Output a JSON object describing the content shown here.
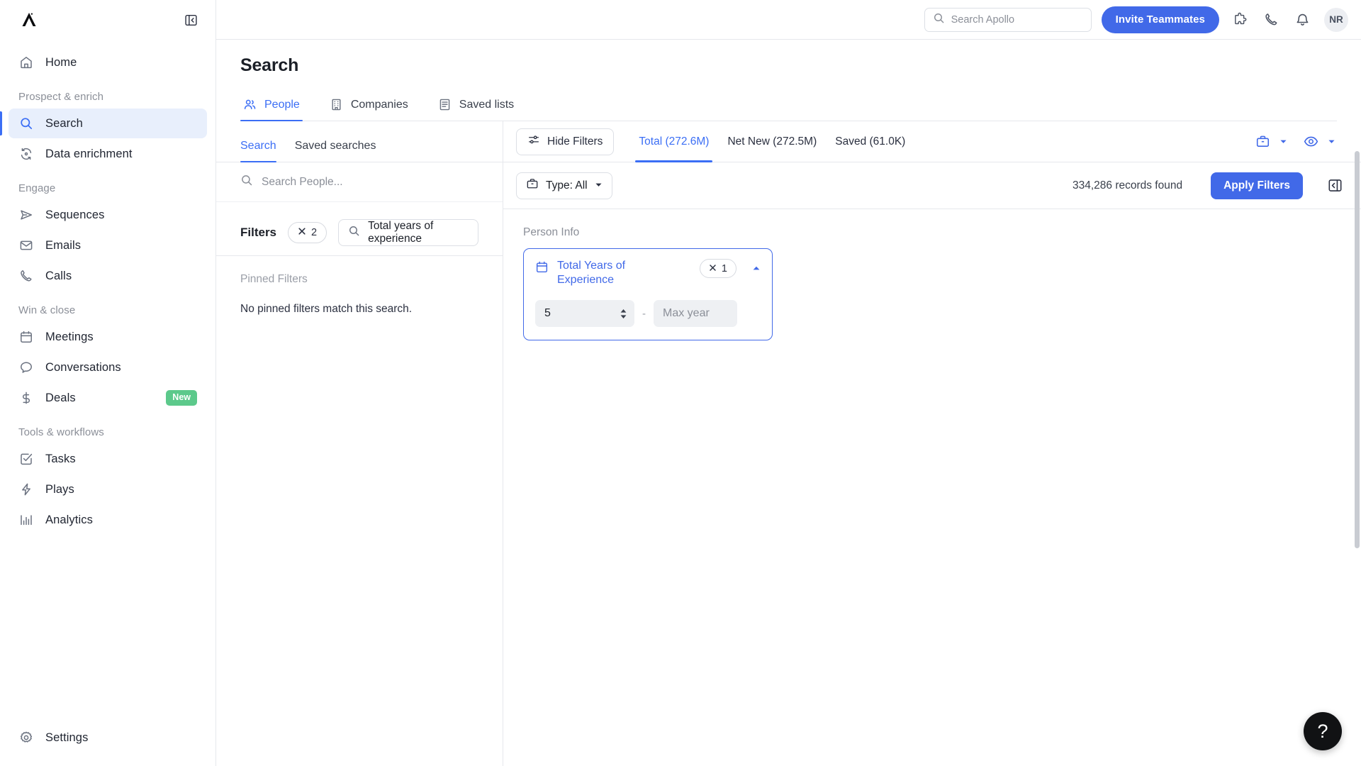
{
  "sidebar": {
    "logo": "apollo-logo",
    "collapse_icon": "panel-collapse-icon",
    "home": {
      "label": "Home",
      "icon": "home-icon"
    },
    "groups": [
      {
        "label": "Prospect & enrich",
        "items": [
          {
            "label": "Search",
            "icon": "search-icon",
            "active": true
          },
          {
            "label": "Data enrichment",
            "icon": "refresh-data-icon",
            "active": false
          }
        ]
      },
      {
        "label": "Engage",
        "items": [
          {
            "label": "Sequences",
            "icon": "send-icon",
            "active": false
          },
          {
            "label": "Emails",
            "icon": "envelope-icon",
            "active": false
          },
          {
            "label": "Calls",
            "icon": "phone-icon",
            "active": false
          }
        ]
      },
      {
        "label": "Win & close",
        "items": [
          {
            "label": "Meetings",
            "icon": "calendar-icon",
            "active": false
          },
          {
            "label": "Conversations",
            "icon": "chat-bubble-icon",
            "active": false
          },
          {
            "label": "Deals",
            "icon": "dollar-icon",
            "active": false,
            "badge": "New"
          }
        ]
      },
      {
        "label": "Tools & workflows",
        "items": [
          {
            "label": "Tasks",
            "icon": "checkbox-icon",
            "active": false
          },
          {
            "label": "Plays",
            "icon": "lightning-icon",
            "active": false
          },
          {
            "label": "Analytics",
            "icon": "bar-chart-icon",
            "active": false
          }
        ]
      }
    ],
    "settings": {
      "label": "Settings",
      "icon": "gear-icon"
    }
  },
  "topbar": {
    "search": {
      "placeholder": "Search Apollo",
      "icon": "search-icon"
    },
    "invite_label": "Invite Teammates",
    "icons": [
      "puzzle-piece-icon",
      "phone-icon",
      "bell-icon"
    ],
    "avatar_initials": "NR"
  },
  "page": {
    "title": "Search",
    "tabs": [
      {
        "label": "People",
        "icon": "people-icon",
        "active": true
      },
      {
        "label": "Companies",
        "icon": "building-icon",
        "active": false
      },
      {
        "label": "Saved lists",
        "icon": "list-icon",
        "active": false
      }
    ]
  },
  "left_panel": {
    "tabs": [
      {
        "label": "Search",
        "active": true
      },
      {
        "label": "Saved searches",
        "active": false
      }
    ],
    "search_placeholder": "Search People...",
    "pinned_title": "Pinned Filters",
    "pinned_empty": "No pinned filters match this search."
  },
  "results_toolbar": {
    "hide_filters_label": "Hide Filters",
    "hide_filters_icon": "sliders-icon",
    "count_tabs": [
      {
        "label": "Total (272.6M)",
        "active": true
      },
      {
        "label": "Net New (272.5M)",
        "active": false
      },
      {
        "label": "Saved (61.0K)",
        "active": false
      }
    ],
    "right_icons": [
      "briefcase-icon",
      "chevron-down-icon",
      "eye-icon",
      "chevron-down-icon"
    ]
  },
  "filters_bar": {
    "label": "Filters",
    "clear_count": "2",
    "clear_icon": "close-icon",
    "search_value": "Total years of experience",
    "search_icon": "search-icon",
    "type_label": "Type: All",
    "type_icon": "briefcase-icon",
    "records_found": "334,286 records found",
    "apply_label": "Apply Filters",
    "panel_toggle_icon": "panel-collapse-icon"
  },
  "filter_section": {
    "title": "Person Info",
    "card": {
      "icon": "calendar-icon",
      "title": "Total Years of Experience",
      "chip_count": "1",
      "chip_icon": "close-icon",
      "collapse_icon": "chevron-up-icon",
      "min_value": "5",
      "separator": "-",
      "max_placeholder": "Max year",
      "spinner_icon": "stepper-icon"
    }
  },
  "help": {
    "label": "?"
  },
  "colors": {
    "accent": "#4169e8",
    "accent_light": "#3b6ef5",
    "active_bg": "#e8effc",
    "badge_green": "#5cc98b",
    "text": "#1b1f27",
    "muted": "#8b8f98",
    "border": "#e6e8ec"
  }
}
